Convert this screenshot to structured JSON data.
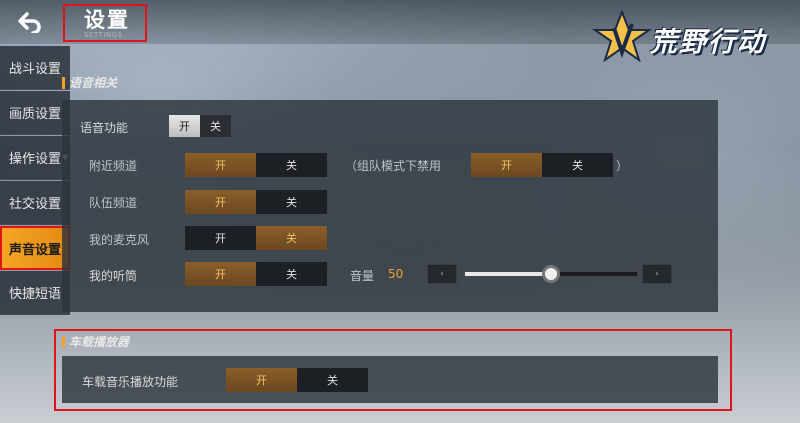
{
  "header": {
    "title": "设置",
    "subtitle": "SETTINGS",
    "logo_text": "荒野行动"
  },
  "sidebar": {
    "items": [
      {
        "label": "战斗设置",
        "active": false
      },
      {
        "label": "画质设置",
        "active": false
      },
      {
        "label": "操作设置",
        "active": false,
        "has_caret": true
      },
      {
        "label": "社交设置",
        "active": false
      },
      {
        "label": "声音设置",
        "active": true
      },
      {
        "label": "快捷短语",
        "active": false
      }
    ]
  },
  "voice_section": {
    "title": "语音相关",
    "voice_function": {
      "label": "语音功能",
      "on": "开",
      "off": "关",
      "selected": "on"
    },
    "nearby_channel": {
      "label": "附近频道",
      "on": "开",
      "off": "关",
      "selected": "on"
    },
    "team_mode_note": "（组队模式下禁用",
    "team_mode_close": "）",
    "team_mode_toggle": {
      "on": "开",
      "off": "关",
      "selected": "on"
    },
    "team_channel": {
      "label": "队伍频道",
      "on": "开",
      "off": "关",
      "selected": "on"
    },
    "my_mic": {
      "label": "我的麦克风",
      "on": "开",
      "off": "关",
      "selected": "off"
    },
    "my_earpiece": {
      "label": "我的听筒",
      "on": "开",
      "off": "关",
      "selected": "on"
    },
    "volume": {
      "label": "音量",
      "value": "50",
      "level": 0.5,
      "dec": "‹",
      "inc": "›"
    }
  },
  "car_section": {
    "title": "车载播放器",
    "car_music": {
      "label": "车载音乐播放功能",
      "on": "开",
      "off": "关",
      "selected": "on"
    }
  },
  "colors": {
    "accent": "#f2a12c",
    "highlight_border": "#e0141a",
    "panel": "#2d343c"
  }
}
